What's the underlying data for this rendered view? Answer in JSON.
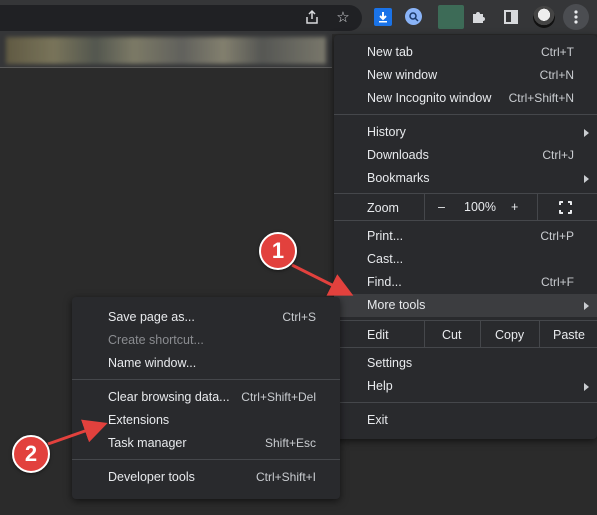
{
  "toolbar": {
    "icons": [
      "share-icon",
      "bookmark-star-icon",
      "download-extension-icon",
      "lens-extension-icon",
      "image-extension-icon",
      "puzzle-extensions-icon",
      "side-panel-icon",
      "profile-avatar",
      "kebab-menu-icon"
    ]
  },
  "main_menu": {
    "new_tab": {
      "label": "New tab",
      "shortcut": "Ctrl+T"
    },
    "new_window": {
      "label": "New window",
      "shortcut": "Ctrl+N"
    },
    "new_incognito": {
      "label": "New Incognito window",
      "shortcut": "Ctrl+Shift+N"
    },
    "history": {
      "label": "History"
    },
    "downloads": {
      "label": "Downloads",
      "shortcut": "Ctrl+J"
    },
    "bookmarks": {
      "label": "Bookmarks"
    },
    "zoom": {
      "label": "Zoom",
      "minus": "–",
      "value": "100%",
      "plus": "+"
    },
    "print": {
      "label": "Print...",
      "shortcut": "Ctrl+P"
    },
    "cast": {
      "label": "Cast..."
    },
    "find": {
      "label": "Find...",
      "shortcut": "Ctrl+F"
    },
    "more_tools": {
      "label": "More tools"
    },
    "edit": {
      "label": "Edit",
      "cut": "Cut",
      "copy": "Copy",
      "paste": "Paste"
    },
    "settings": {
      "label": "Settings"
    },
    "help": {
      "label": "Help"
    },
    "exit": {
      "label": "Exit"
    }
  },
  "sub_menu": {
    "save_page": {
      "label": "Save page as...",
      "shortcut": "Ctrl+S"
    },
    "create_shortcut": {
      "label": "Create shortcut..."
    },
    "name_window": {
      "label": "Name window..."
    },
    "clear_data": {
      "label": "Clear browsing data...",
      "shortcut": "Ctrl+Shift+Del"
    },
    "extensions": {
      "label": "Extensions"
    },
    "task_manager": {
      "label": "Task manager",
      "shortcut": "Shift+Esc"
    },
    "dev_tools": {
      "label": "Developer tools",
      "shortcut": "Ctrl+Shift+I"
    }
  },
  "callouts": {
    "one": "1",
    "two": "2"
  },
  "colors": {
    "callout": "#e2413d",
    "menu_bg": "#292a2d",
    "highlight": "#3c3d40"
  }
}
